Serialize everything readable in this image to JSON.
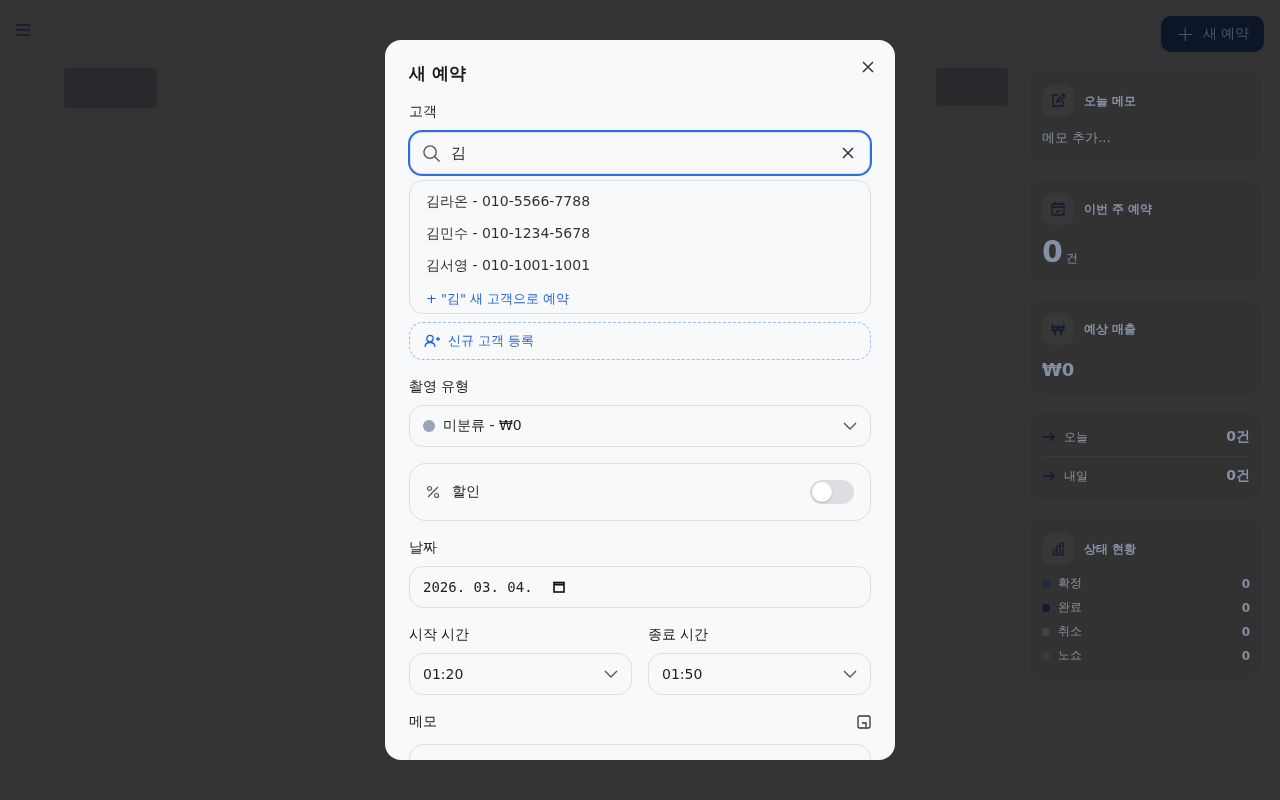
{
  "header": {
    "new_button": {
      "icon": "+",
      "label": "새 예약"
    }
  },
  "sidebar": {
    "memo_card": {
      "title": "오늘 메모",
      "placeholder": "메모 추가..."
    },
    "week_card": {
      "title": "이번 주 예약",
      "count": "0",
      "unit": "건"
    },
    "revenue_card": {
      "title": "예상 매출",
      "amount": "₩0"
    },
    "upcoming": [
      {
        "label": "오늘",
        "count": "0건"
      },
      {
        "label": "내일",
        "count": "0건"
      }
    ],
    "status_card": {
      "title": "상태 현황",
      "statuses": [
        {
          "label": "확정",
          "count": "0",
          "color": "#1c2840"
        },
        {
          "label": "완료",
          "count": "0",
          "color": "#101c36"
        },
        {
          "label": "취소",
          "count": "0",
          "color": "#444444"
        },
        {
          "label": "노쇼",
          "count": "0",
          "color": "#3b3b3b"
        }
      ]
    }
  },
  "modal": {
    "title": "새 예약",
    "customer": {
      "label": "고객",
      "value": "김",
      "suggestions": [
        {
          "text": "김라온 - 010-5566-7788",
          "kind": "customer"
        },
        {
          "text": "김민수 - 010-1234-5678",
          "kind": "customer"
        },
        {
          "text": "김서영 - 010-1001-1001",
          "kind": "customer"
        },
        {
          "text": "+ \"김\" 새 고객으로 예약",
          "kind": "new"
        }
      ],
      "register_button": "신규 고객 등록"
    },
    "shoot_type": {
      "label": "촬영 유형",
      "value": "미분류 - ₩0",
      "color": "#9aa5b8"
    },
    "discount": {
      "label": "할인",
      "on": false
    },
    "date": {
      "label": "날짜",
      "value": "2026. 03. 04."
    },
    "start_time": {
      "label": "시작 시간",
      "value": "01:20"
    },
    "end_time": {
      "label": "종료 시간",
      "value": "01:50"
    },
    "memo": {
      "label": "메모"
    }
  }
}
